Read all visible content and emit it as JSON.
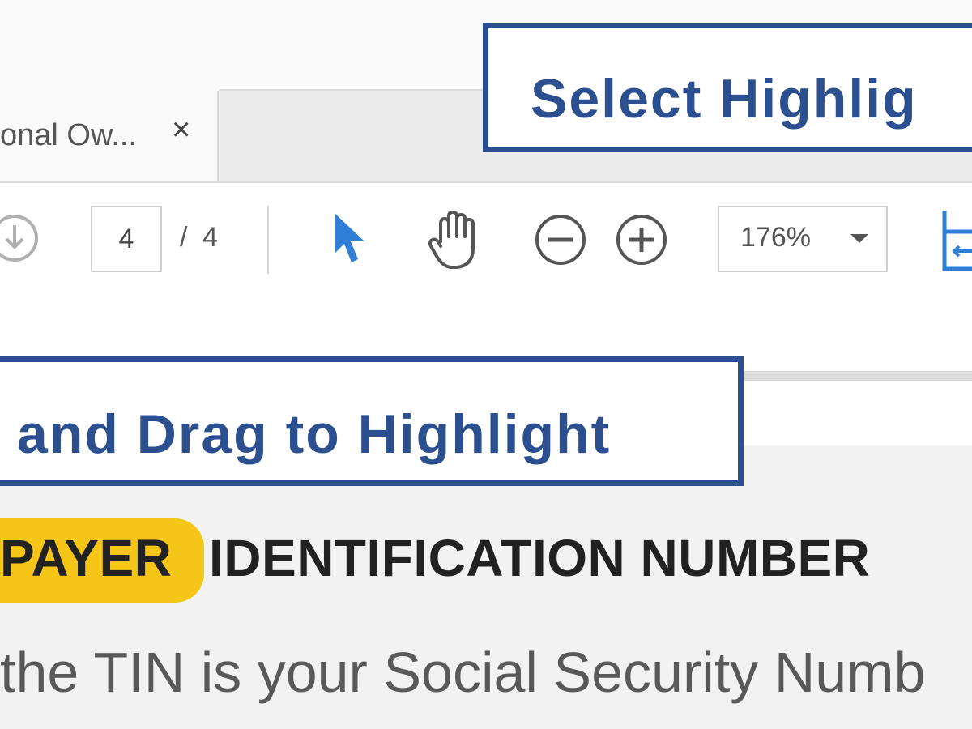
{
  "tab": {
    "title": "onal Ow...",
    "close_label": "×"
  },
  "toolbar": {
    "page_current": "4",
    "page_separator": "/",
    "page_total": "4",
    "zoom_value": "176%",
    "icons": [
      "download-icon",
      "select-arrow-icon",
      "hand-tool-icon",
      "zoom-out-icon",
      "zoom-in-icon",
      "compare-icon"
    ]
  },
  "document": {
    "highlighted_word": "PAYER",
    "heading_rest": "IDENTIFICATION NUMBER",
    "body_line_1": "the TIN is your Social Security Numb",
    "highlight_color": "#f5c518"
  },
  "callouts": {
    "top": "Select Highlig",
    "middle": "and Drag to Highlight",
    "color": "#2b4f8f"
  }
}
